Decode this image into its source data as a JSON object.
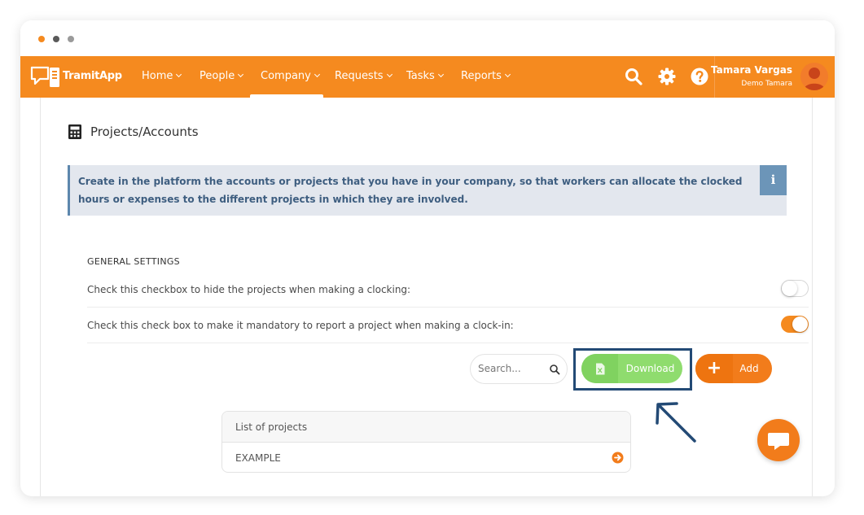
{
  "app": {
    "name": "TramitApp"
  },
  "colors": {
    "brand": "#f58a1f",
    "download_green": "#8fdc6e",
    "info_blue": "#6c95b8"
  },
  "nav": {
    "items": [
      {
        "label": "Home"
      },
      {
        "label": "People"
      },
      {
        "label": "Company"
      },
      {
        "label": "Requests"
      },
      {
        "label": "Tasks"
      },
      {
        "label": "Reports"
      }
    ],
    "active": "Company",
    "icons": [
      "search-icon",
      "gear-icon",
      "help-icon"
    ]
  },
  "user": {
    "name": "Tamara Vargas",
    "company": "Demo Tamara"
  },
  "page": {
    "title": "Projects/Accounts",
    "info_text": "Create in the platform the accounts or projects that you have in your company, so that workers can allocate the clocked hours or expenses to the different projects in which they are involved.",
    "info_icon": "i"
  },
  "settings": {
    "section_label": "GENERAL SETTINGS",
    "items": [
      {
        "text": "Check this checkbox to hide the projects when making a clocking:",
        "enabled": false
      },
      {
        "text": "Check this check box to make it mandatory to report a project when making a clock-in:",
        "enabled": true
      }
    ]
  },
  "toolbar": {
    "search_placeholder": "Search...",
    "download_label": "Download",
    "add_label": "Add",
    "add_icon": "+"
  },
  "projects": {
    "header": "List of projects",
    "rows": [
      {
        "name": "EXAMPLE"
      }
    ]
  }
}
